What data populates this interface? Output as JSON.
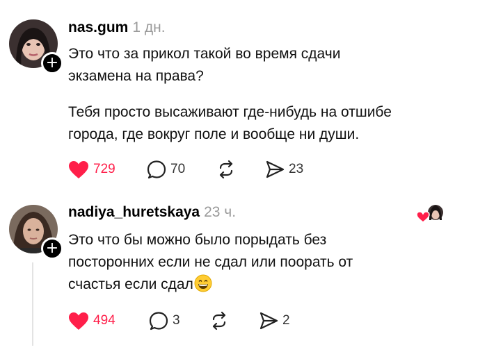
{
  "comments": [
    {
      "username": "nas.gum",
      "time": "1 дн.",
      "paragraphs": [
        [
          "Это что за прикол такой во время сдачи",
          "экзамена на права?"
        ],
        [
          "Тебя просто высаживают где-нибудь на отшибе",
          "города, где вокруг поле и вообще ни души."
        ]
      ],
      "likes": "729",
      "replies": "70",
      "shares": "23",
      "liked": true
    },
    {
      "username": "nadiya_huretskaya",
      "time": "23 ч.",
      "lines": [
        "Это что бы можно было порыдать без",
        "посторонних если не сдал или поорать от",
        "счастья если сдал"
      ],
      "likes": "494",
      "replies": "3",
      "shares": "2",
      "liked": true
    }
  ],
  "icons": {
    "like": "heart-icon",
    "reply": "comment-bubble-icon",
    "repost": "repost-icon",
    "share": "send-icon",
    "follow": "plus-icon",
    "emoji": "grinning-face-emoji"
  },
  "colors": {
    "like": "#ff1f4a",
    "muted": "#9a9a9a"
  }
}
